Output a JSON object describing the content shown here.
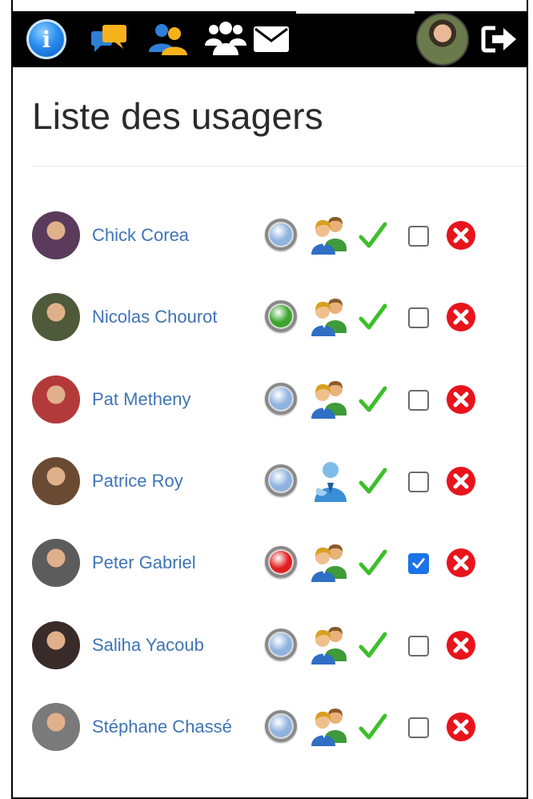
{
  "page": {
    "title": "Liste des usagers"
  },
  "navbar": {
    "info_glyph": "i",
    "icons": [
      "info-icon",
      "chat-icon",
      "users-icon",
      "group-icon",
      "mail-icon",
      "profile-avatar",
      "logout-icon"
    ]
  },
  "status_colors": {
    "offline": "#8fb3e0",
    "online": "#3aa62b",
    "busy": "#e21f1f"
  },
  "users": [
    {
      "name": "Chick Corea",
      "status": "offline",
      "role": "group-icon",
      "checked": false,
      "avatar_color": "#5a3b5c"
    },
    {
      "name": "Nicolas Chourot",
      "status": "online",
      "role": "group-icon",
      "checked": false,
      "avatar_color": "#4f5a3a"
    },
    {
      "name": "Pat Metheny",
      "status": "offline",
      "role": "group-icon",
      "checked": false,
      "avatar_color": "#b33a3a"
    },
    {
      "name": "Patrice Roy",
      "status": "offline",
      "role": "admin-icon",
      "checked": false,
      "avatar_color": "#6b4a33"
    },
    {
      "name": "Peter Gabriel",
      "status": "busy",
      "role": "group-icon",
      "checked": true,
      "avatar_color": "#5c5c5c"
    },
    {
      "name": "Saliha Yacoub",
      "status": "offline",
      "role": "group-icon",
      "checked": false,
      "avatar_color": "#3a2b2b"
    },
    {
      "name": "Stéphane Chassé",
      "status": "offline",
      "role": "group-icon",
      "checked": false,
      "avatar_color": "#7a7a7a"
    }
  ]
}
